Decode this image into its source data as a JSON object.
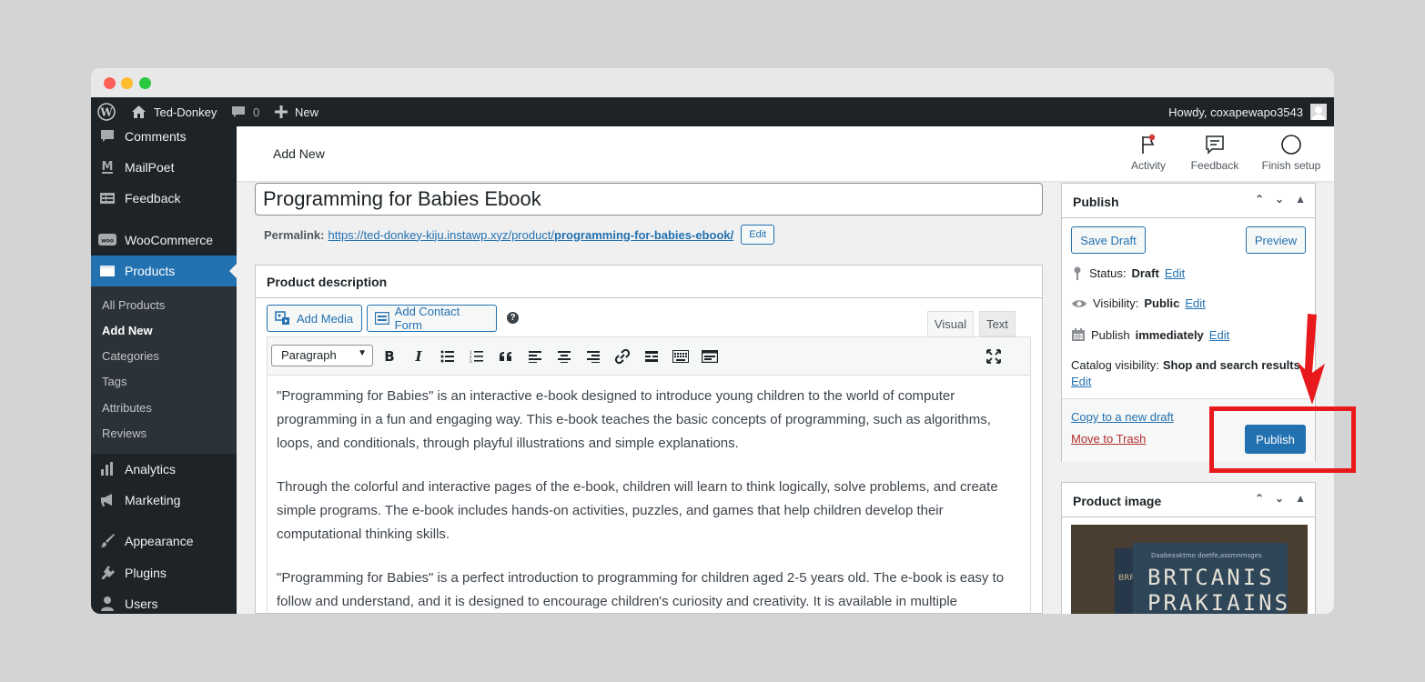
{
  "adminbar": {
    "site_name": "Ted-Donkey",
    "comment_count": "0",
    "new_label": "New",
    "howdy": "Howdy, coxapewapo3543"
  },
  "sidebar": {
    "items": [
      {
        "label": "Comments",
        "icon": "comment-icon"
      },
      {
        "label": "MailPoet",
        "icon": "mailpoet-icon"
      },
      {
        "label": "Feedback",
        "icon": "feedback-icon"
      },
      {
        "label": "WooCommerce",
        "icon": "woo-icon"
      },
      {
        "label": "Products",
        "icon": "products-icon"
      },
      {
        "label": "Analytics",
        "icon": "analytics-icon"
      },
      {
        "label": "Marketing",
        "icon": "megaphone-icon"
      },
      {
        "label": "Appearance",
        "icon": "brush-icon"
      },
      {
        "label": "Plugins",
        "icon": "plugin-icon"
      },
      {
        "label": "Users",
        "icon": "user-icon"
      }
    ],
    "submenu": [
      "All Products",
      "Add New",
      "Categories",
      "Tags",
      "Attributes",
      "Reviews"
    ]
  },
  "header": {
    "page_title": "Add New",
    "activity": "Activity",
    "feedback": "Feedback",
    "finish_setup": "Finish setup"
  },
  "editor": {
    "title": "Programming for Babies Ebook",
    "permalink_label": "Permalink:",
    "permalink_base": "https://ted-donkey-kiju.instawp.xyz/product/",
    "permalink_slug": "programming-for-babies-ebook/",
    "permalink_edit": "Edit",
    "box_title": "Product description",
    "add_media": "Add Media",
    "add_contact_form": "Add Contact Form",
    "tab_visual": "Visual",
    "tab_text": "Text",
    "format": "Paragraph",
    "paragraphs": [
      "\"Programming for Babies\" is an interactive e-book designed to introduce young children to the world of computer programming in a fun and engaging way. This e-book teaches the basic concepts of programming, such as algorithms, loops, and conditionals, through playful illustrations and simple explanations.",
      "Through the colorful and interactive pages of the e-book, children will learn to think logically, solve problems, and create simple programs. The e-book includes hands-on activities, puzzles, and games that help children develop their computational thinking skills.",
      "\"Programming for Babies\" is a perfect introduction to programming for children aged 2-5 years old. The e-book is easy to follow and understand, and it is designed to encourage children's curiosity and creativity. It is available in multiple"
    ]
  },
  "publish": {
    "title": "Publish",
    "save_draft": "Save Draft",
    "preview": "Preview",
    "status_label": "Status:",
    "status_value": "Draft",
    "visibility_label": "Visibility:",
    "visibility_value": "Public",
    "publish_label": "Publish",
    "publish_value": "immediately",
    "edit": "Edit",
    "catalog_label": "Catalog visibility:",
    "catalog_value": "Shop and search results",
    "copy_draft": "Copy to a new draft",
    "trash": "Move to Trash",
    "publish_button": "Publish"
  },
  "product_image": {
    "title": "Product image",
    "cover_line1": "BRTCANIS",
    "cover_line2": "PRAKIAINS",
    "cover_small": "Daabexaktmo doetfe,assmnmsges",
    "spine": "BRR"
  },
  "colors": {
    "accent": "#2271b1",
    "admin_dark": "#1d2327",
    "highlight_red": "#e8191d"
  }
}
